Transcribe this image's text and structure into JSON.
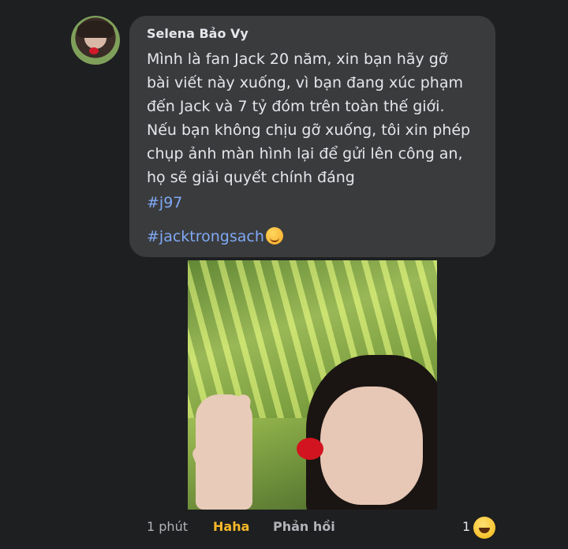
{
  "comment": {
    "author": "Selena Bảo Vy",
    "lines": [
      "Mình là fan Jack 20 năm, xin bạn hãy gỡ",
      "bài viết này xuống, vì bạn đang xúc phạm",
      "đến Jack và 7 tỷ đóm trên toàn thế giới.",
      "Nếu bạn không chịu gỡ xuống, tôi xin phép",
      "chụp ảnh màn hình lại để gửi lên công an,",
      "họ sẽ giải quyết chính đáng"
    ],
    "hashtags": [
      "#j97",
      "#jacktrongsach"
    ]
  },
  "footer": {
    "time": "1 phút",
    "reaction_label": "Haha",
    "reply_label": "Phản hồi",
    "reaction_count": "1"
  },
  "colors": {
    "background": "#1e1f21",
    "bubble": "#3a3b3d",
    "hashtag": "#7fa9f5",
    "haha": "#f7b928"
  },
  "icons": {
    "avatar": "profile-photo",
    "emoji": "smirk-emoji",
    "reaction": "haha-reaction-icon"
  }
}
